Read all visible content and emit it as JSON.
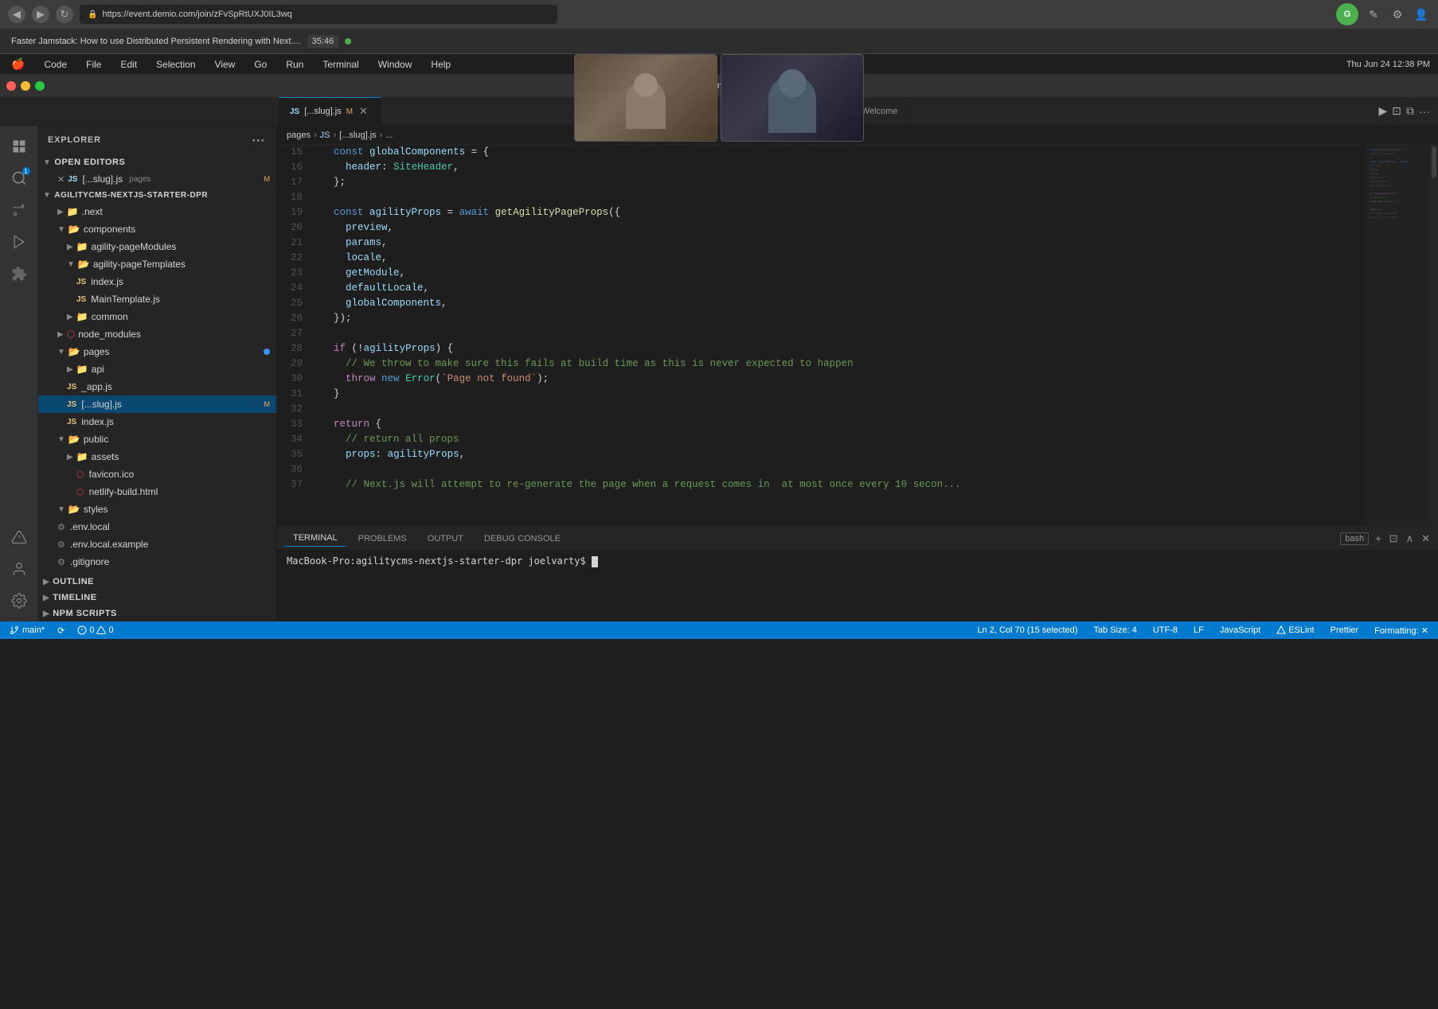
{
  "browser": {
    "url": "https://event.demio.com/join/zFvSpRtUXJ0IL3wq",
    "back_btn": "◀",
    "forward_btn": "▶",
    "reload_btn": "↻"
  },
  "notification": {
    "title": "Faster Jamstack: How to use Distributed Persistent Rendering with Next....",
    "timer": "35:46",
    "dot_color": "#4caf50"
  },
  "macos": {
    "apple": "",
    "menus": [
      "Code",
      "File",
      "Edit",
      "Selection",
      "View",
      "Go",
      "Run",
      "Terminal",
      "Window",
      "Help"
    ],
    "time": "Thu Jun 24  12:38 PM"
  },
  "vscode": {
    "title": "[...slug].js — agilitycms-nextjs-starter-dpr",
    "tabs": [
      {
        "label": "[...slug].js",
        "lang": "JS",
        "modified": true,
        "active": true
      },
      {
        "label": "Welcome",
        "active": false
      }
    ],
    "breadcrumb": [
      "pages",
      "JS",
      "[...slug].js",
      "..."
    ],
    "window_title": "[...slug].js — agilitycms-nextjs-starter-dpr"
  },
  "sidebar": {
    "title": "EXPLORER",
    "sections": {
      "open_editors": {
        "label": "OPEN EDITORS",
        "items": [
          {
            "name": "[...slug].js",
            "context": "pages",
            "lang": "JS",
            "modified": true
          }
        ]
      },
      "project": {
        "label": "AGILITYCMS-NEXTJS-STARTER-DPR",
        "items": [
          {
            "name": ".next",
            "type": "folder",
            "indent": 1
          },
          {
            "name": "components",
            "type": "folder-open",
            "indent": 1
          },
          {
            "name": "agility-pageModules",
            "type": "folder",
            "indent": 2
          },
          {
            "name": "agility-pageTemplates",
            "type": "folder-open",
            "indent": 2
          },
          {
            "name": "index.js",
            "type": "js",
            "indent": 3
          },
          {
            "name": "MainTemplate.js",
            "type": "js",
            "indent": 3
          },
          {
            "name": "common",
            "type": "folder",
            "indent": 2
          },
          {
            "name": "node_modules",
            "type": "folder-npm",
            "indent": 1
          },
          {
            "name": "pages",
            "type": "folder-open",
            "indent": 1,
            "new": true
          },
          {
            "name": "api",
            "type": "folder",
            "indent": 2
          },
          {
            "name": "_app.js",
            "type": "js",
            "indent": 2
          },
          {
            "name": "[...slug].js",
            "type": "js",
            "indent": 2,
            "modified": true,
            "active": true
          },
          {
            "name": "index.js",
            "type": "js",
            "indent": 2
          },
          {
            "name": "public",
            "type": "folder-open",
            "indent": 1
          },
          {
            "name": "assets",
            "type": "folder",
            "indent": 2
          },
          {
            "name": "favicon.ico",
            "type": "ico",
            "indent": 3
          },
          {
            "name": "netlify-build.html",
            "type": "html",
            "indent": 3
          },
          {
            "name": "styles",
            "type": "folder-open",
            "indent": 1
          },
          {
            "name": ".env.local",
            "type": "env",
            "indent": 1
          },
          {
            "name": ".env.local.example",
            "type": "env",
            "indent": 1
          },
          {
            "name": ".gitignore",
            "type": "git",
            "indent": 1
          }
        ]
      }
    }
  },
  "code": {
    "language": "JavaScript",
    "lines": [
      {
        "num": 15,
        "content": "  const globalComponents = {"
      },
      {
        "num": 16,
        "content": "    header: SiteHeader,"
      },
      {
        "num": 17,
        "content": "  };"
      },
      {
        "num": 18,
        "content": ""
      },
      {
        "num": 19,
        "content": "  const agilityProps = await getAgilityPageProps({"
      },
      {
        "num": 20,
        "content": "    preview,"
      },
      {
        "num": 21,
        "content": "    params,"
      },
      {
        "num": 22,
        "content": "    locale,"
      },
      {
        "num": 23,
        "content": "    getModule,"
      },
      {
        "num": 24,
        "content": "    defaultLocale,"
      },
      {
        "num": 25,
        "content": "    globalComponents,"
      },
      {
        "num": 26,
        "content": "  });"
      },
      {
        "num": 27,
        "content": ""
      },
      {
        "num": 28,
        "content": "  if (!agilityProps) {"
      },
      {
        "num": 29,
        "content": "    // We throw to make sure this fails at build time as this is never expected to happen"
      },
      {
        "num": 30,
        "content": "    throw new Error(`Page not found`);"
      },
      {
        "num": 31,
        "content": "  }"
      },
      {
        "num": 32,
        "content": ""
      },
      {
        "num": 33,
        "content": "  return {"
      },
      {
        "num": 34,
        "content": "    // return all props"
      },
      {
        "num": 35,
        "content": "    props: agilityProps,"
      },
      {
        "num": 36,
        "content": ""
      },
      {
        "num": 37,
        "content": "    // Next.js will attempt to re-generate the page when a request comes in  at most once every 10 secon..."
      }
    ]
  },
  "terminal": {
    "tabs": [
      "TERMINAL",
      "PROBLEMS",
      "OUTPUT",
      "DEBUG CONSOLE"
    ],
    "active_tab": "TERMINAL",
    "bash_label": "bash",
    "prompt": "MacBook-Pro:agilitycms-nextjs-starter-dpr joelvarty$ "
  },
  "status_bar": {
    "branch": "main*",
    "sync_icon": "⟳",
    "errors": "0",
    "warnings": "0",
    "position": "Ln 2, Col 70 (15 selected)",
    "tab_size": "Tab Size: 4",
    "encoding": "UTF-8",
    "line_ending": "LF",
    "language": "JavaScript",
    "eslint": "ESLint",
    "prettier": "Prettier",
    "formatting": "Formatting: ✕"
  }
}
